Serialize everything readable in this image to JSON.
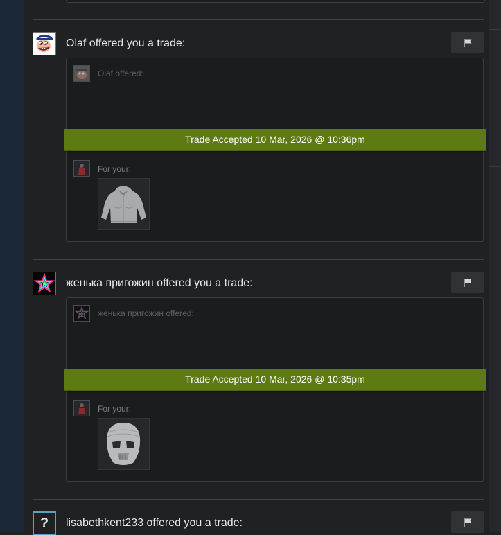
{
  "trades": [
    {
      "headline": "Olaf offered you a trade:",
      "offered_label": "Olaf offered:",
      "status": "Trade Accepted 10 Mar, 2026 @ 10:36pm",
      "for_label": "For your:",
      "avatar_icon": "cartoon-face-avatar",
      "item_icon": "hoodie-icon",
      "accent_color": "#5d7a14"
    },
    {
      "headline": "женька пригожин offered you a trade:",
      "offered_label": "женька пригожин offered:",
      "status": "Trade Accepted 10 Mar, 2026 @ 10:35pm",
      "for_label": "For your:",
      "avatar_icon": "rainbow-star-avatar",
      "item_icon": "hockey-mask-icon",
      "accent_color": "#5d7a14"
    },
    {
      "headline": "lisabethkent233 offered you a trade:",
      "avatar_icon": "question-mark-avatar",
      "avatar_text": "?"
    }
  ],
  "flag_icon": "flag-icon"
}
